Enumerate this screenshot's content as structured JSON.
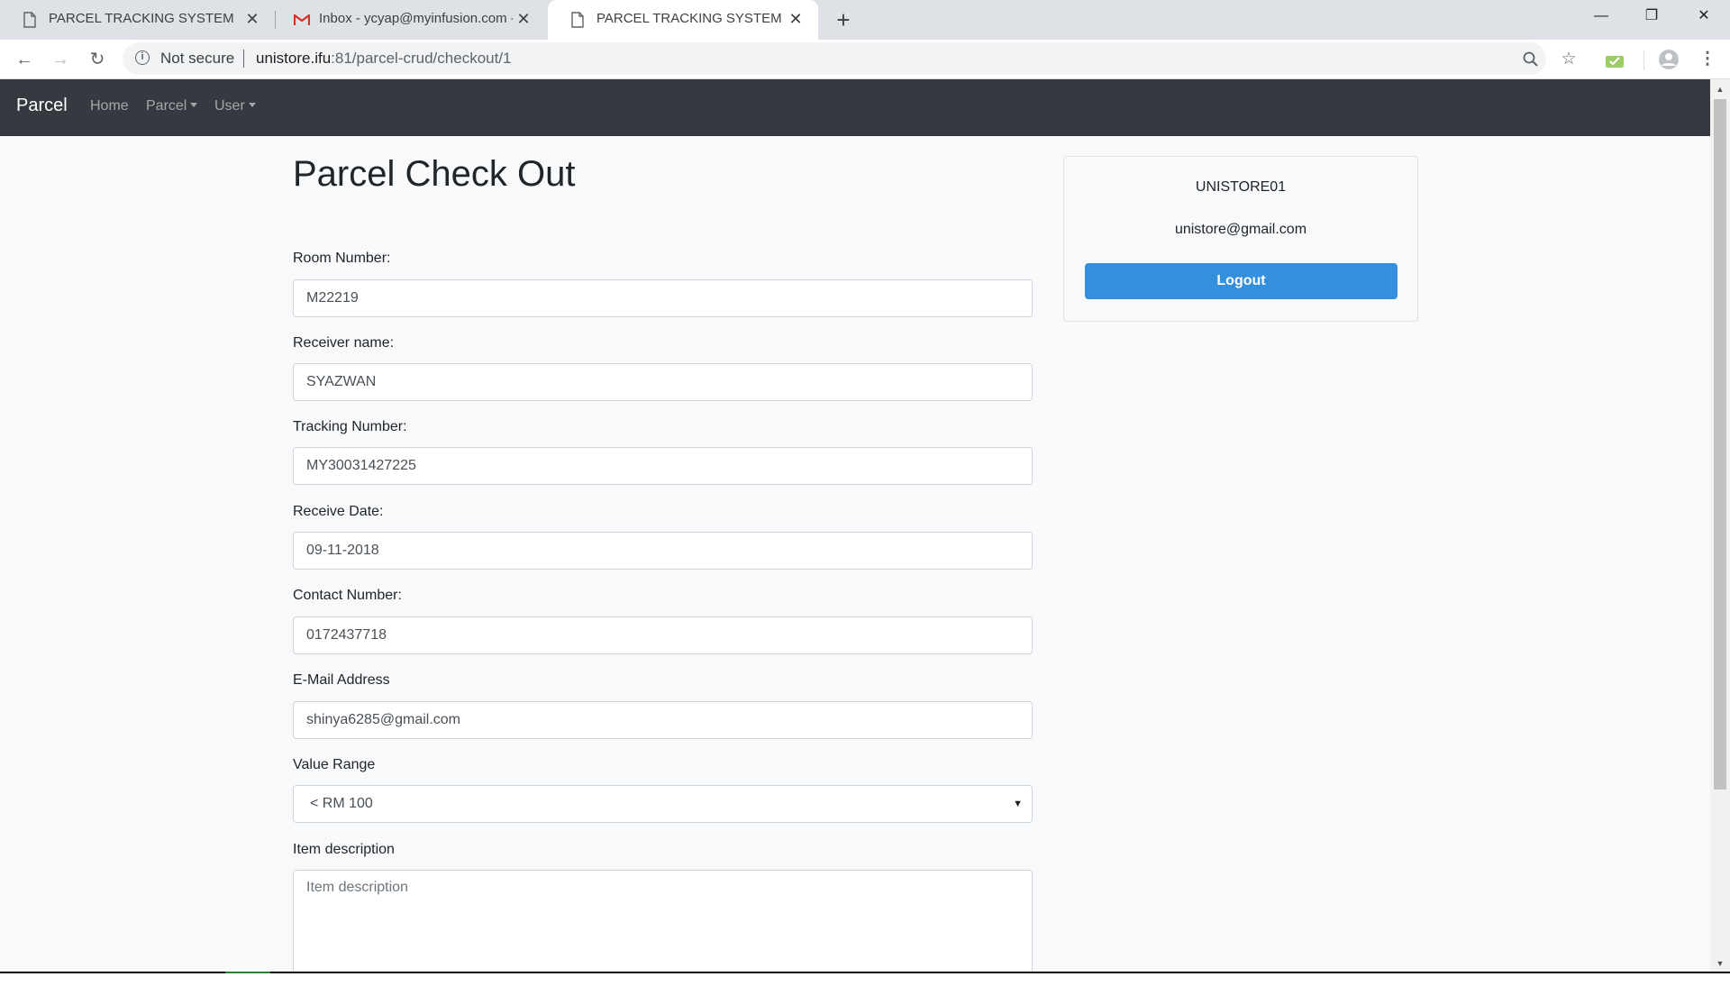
{
  "browser": {
    "tabs": [
      {
        "title": "PARCEL TRACKING SYSTEM",
        "icon": "document-icon",
        "close": "✕"
      },
      {
        "title": "Inbox - ycyap@myinfusion.com - ",
        "icon": "gmail-icon",
        "close": "✕"
      },
      {
        "title": "PARCEL TRACKING SYSTEM",
        "icon": "document-icon",
        "close": "✕"
      }
    ],
    "new_tab": "+",
    "window_controls": {
      "minimize": "—",
      "maximize": "❐",
      "close": "✕"
    },
    "security_text": "Not secure",
    "url_host": "unistore.ifu",
    "url_rest": ":81/parcel-crud/checkout/1"
  },
  "navbar": {
    "brand": "Parcel",
    "links": [
      "Home",
      "Parcel",
      "User"
    ]
  },
  "form": {
    "title": "Parcel Check Out",
    "room_label": "Room Number:",
    "room_value": "M22219",
    "receiver_label": "Receiver name:",
    "receiver_value": "SYAZWAN",
    "tracking_label": "Tracking Number:",
    "tracking_value": "MY30031427225",
    "date_label": "Receive Date:",
    "date_value": "09-11-2018",
    "contact_label": "Contact Number:",
    "contact_value": "0172437718",
    "email_label": "E-Mail Address",
    "email_value": "shinya6285@gmail.com",
    "value_label": "Value Range",
    "value_selected": "< RM 100",
    "desc_label": "Item description",
    "desc_placeholder": "Item description"
  },
  "user_card": {
    "username": "UNISTORE01",
    "email": "unistore@gmail.com",
    "logout": "Logout"
  },
  "colors": {
    "navbar": "#343a40",
    "primary_button": "#3490dc",
    "page_background": "#f8f9fa"
  }
}
